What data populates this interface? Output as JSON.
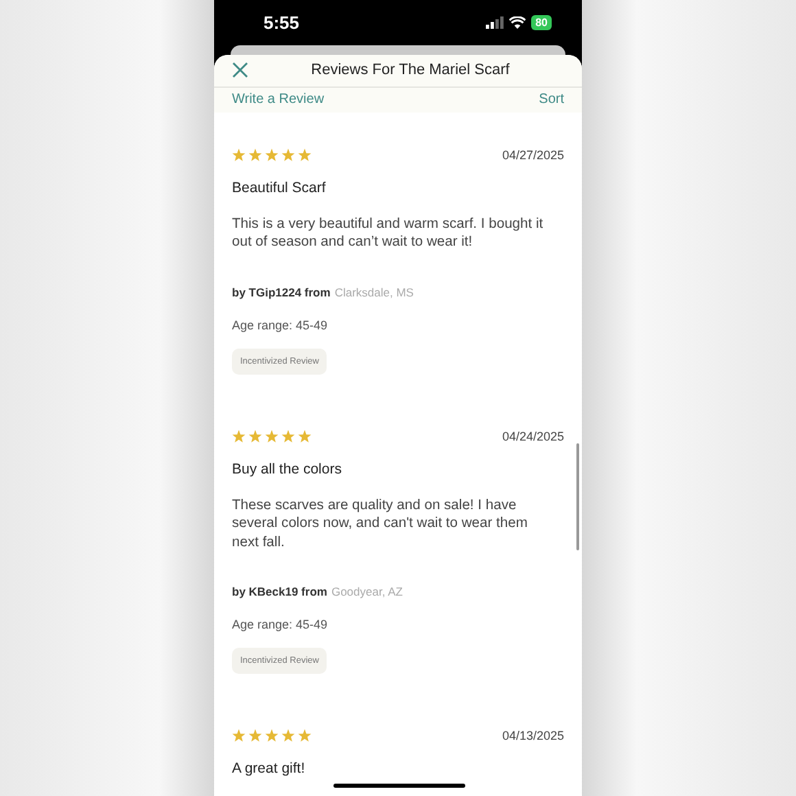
{
  "status_bar": {
    "time": "5:55",
    "battery": "80"
  },
  "header": {
    "title": "Reviews For The Mariel Scarf"
  },
  "toolbar": {
    "write_link": "Write a Review",
    "sort_link": "Sort"
  },
  "reviews": [
    {
      "stars": 5,
      "date": "04/27/2025",
      "title": "Beautiful Scarf",
      "body": "This is a very beautiful and warm scarf. I bought it out of season and can’t wait to wear it!",
      "author": "by TGip1224 from",
      "location": "Clarksdale, MS",
      "age": "Age range: 45-49",
      "badge": "Incentivized Review"
    },
    {
      "stars": 5,
      "date": "04/24/2025",
      "title": "Buy all the colors",
      "body": "These scarves are quality and on sale! I have several colors now, and can't wait to wear them next fall.",
      "author": "by KBeck19 from",
      "location": "Goodyear, AZ",
      "age": "Age range: 45-49",
      "badge": "Incentivized Review"
    },
    {
      "stars": 5,
      "date": "04/13/2025",
      "title": "A great gift!"
    }
  ]
}
